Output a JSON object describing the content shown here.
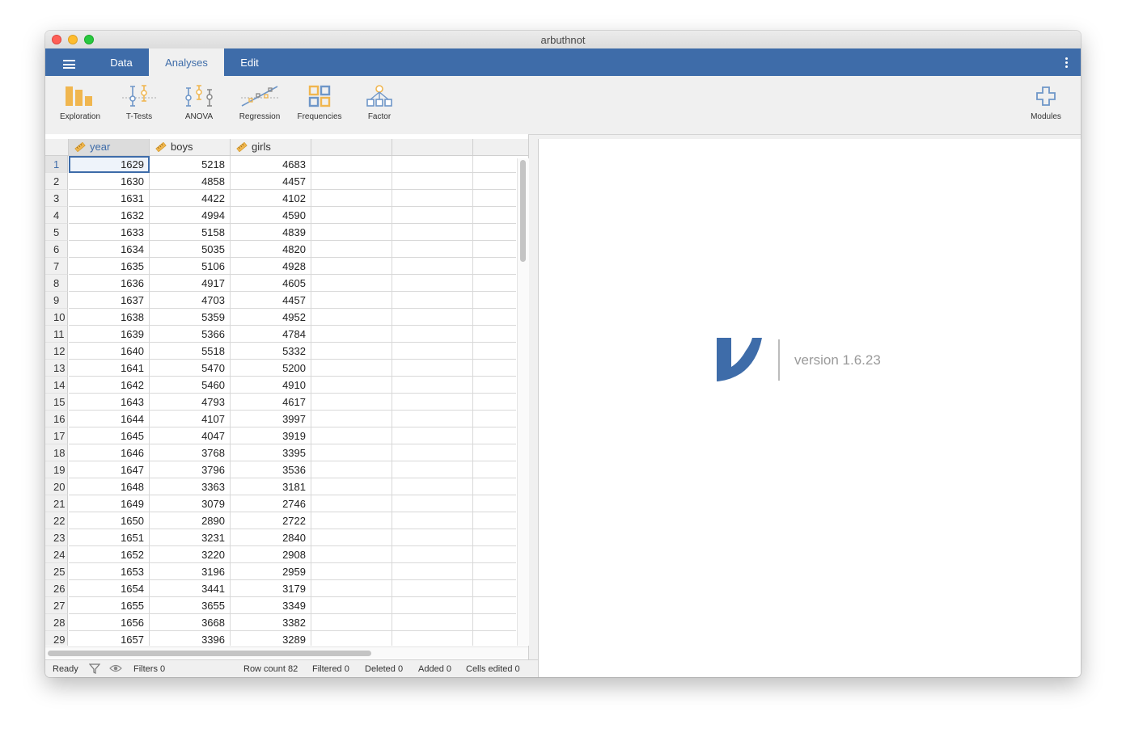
{
  "window": {
    "title": "arbuthnot"
  },
  "menu": {
    "tabs": [
      {
        "label": "Data"
      },
      {
        "label": "Analyses"
      },
      {
        "label": "Edit"
      }
    ],
    "active_tab": "Analyses"
  },
  "ribbon": {
    "buttons": [
      {
        "label": "Exploration",
        "icon": "exploration-icon"
      },
      {
        "label": "T-Tests",
        "icon": "t-tests-icon"
      },
      {
        "label": "ANOVA",
        "icon": "anova-icon"
      },
      {
        "label": "Regression",
        "icon": "regression-icon"
      },
      {
        "label": "Frequencies",
        "icon": "frequencies-icon"
      },
      {
        "label": "Factor",
        "icon": "factor-icon"
      },
      {
        "label": "Modules",
        "icon": "plus-icon"
      }
    ]
  },
  "spreadsheet": {
    "columns": [
      {
        "name": "year",
        "type_icon": "ruler-icon"
      },
      {
        "name": "boys",
        "type_icon": "ruler-icon"
      },
      {
        "name": "girls",
        "type_icon": "ruler-icon"
      }
    ],
    "selected_column": "year",
    "selected_row": 1,
    "rows": [
      {
        "n": "1",
        "year": "1629",
        "boys": "5218",
        "girls": "4683"
      },
      {
        "n": "2",
        "year": "1630",
        "boys": "4858",
        "girls": "4457"
      },
      {
        "n": "3",
        "year": "1631",
        "boys": "4422",
        "girls": "4102"
      },
      {
        "n": "4",
        "year": "1632",
        "boys": "4994",
        "girls": "4590"
      },
      {
        "n": "5",
        "year": "1633",
        "boys": "5158",
        "girls": "4839"
      },
      {
        "n": "6",
        "year": "1634",
        "boys": "5035",
        "girls": "4820"
      },
      {
        "n": "7",
        "year": "1635",
        "boys": "5106",
        "girls": "4928"
      },
      {
        "n": "8",
        "year": "1636",
        "boys": "4917",
        "girls": "4605"
      },
      {
        "n": "9",
        "year": "1637",
        "boys": "4703",
        "girls": "4457"
      },
      {
        "n": "10",
        "year": "1638",
        "boys": "5359",
        "girls": "4952"
      },
      {
        "n": "11",
        "year": "1639",
        "boys": "5366",
        "girls": "4784"
      },
      {
        "n": "12",
        "year": "1640",
        "boys": "5518",
        "girls": "5332"
      },
      {
        "n": "13",
        "year": "1641",
        "boys": "5470",
        "girls": "5200"
      },
      {
        "n": "14",
        "year": "1642",
        "boys": "5460",
        "girls": "4910"
      },
      {
        "n": "15",
        "year": "1643",
        "boys": "4793",
        "girls": "4617"
      },
      {
        "n": "16",
        "year": "1644",
        "boys": "4107",
        "girls": "3997"
      },
      {
        "n": "17",
        "year": "1645",
        "boys": "4047",
        "girls": "3919"
      },
      {
        "n": "18",
        "year": "1646",
        "boys": "3768",
        "girls": "3395"
      },
      {
        "n": "19",
        "year": "1647",
        "boys": "3796",
        "girls": "3536"
      },
      {
        "n": "20",
        "year": "1648",
        "boys": "3363",
        "girls": "3181"
      },
      {
        "n": "21",
        "year": "1649",
        "boys": "3079",
        "girls": "2746"
      },
      {
        "n": "22",
        "year": "1650",
        "boys": "2890",
        "girls": "2722"
      },
      {
        "n": "23",
        "year": "1651",
        "boys": "3231",
        "girls": "2840"
      },
      {
        "n": "24",
        "year": "1652",
        "boys": "3220",
        "girls": "2908"
      },
      {
        "n": "25",
        "year": "1653",
        "boys": "3196",
        "girls": "2959"
      },
      {
        "n": "26",
        "year": "1654",
        "boys": "3441",
        "girls": "3179"
      },
      {
        "n": "27",
        "year": "1655",
        "boys": "3655",
        "girls": "3349"
      },
      {
        "n": "28",
        "year": "1656",
        "boys": "3668",
        "girls": "3382"
      },
      {
        "n": "29",
        "year": "1657",
        "boys": "3396",
        "girls": "3289"
      }
    ]
  },
  "status": {
    "ready": "Ready",
    "filters": "Filters 0",
    "row_count": "Row count 82",
    "filtered": "Filtered 0",
    "deleted": "Deleted 0",
    "added": "Added 0",
    "cells_edited": "Cells edited 0"
  },
  "results": {
    "version": "version 1.6.23"
  },
  "colors": {
    "brand": "#3e6ca9",
    "icon_orange": "#f0b64f",
    "icon_blue": "#6e96c8"
  }
}
